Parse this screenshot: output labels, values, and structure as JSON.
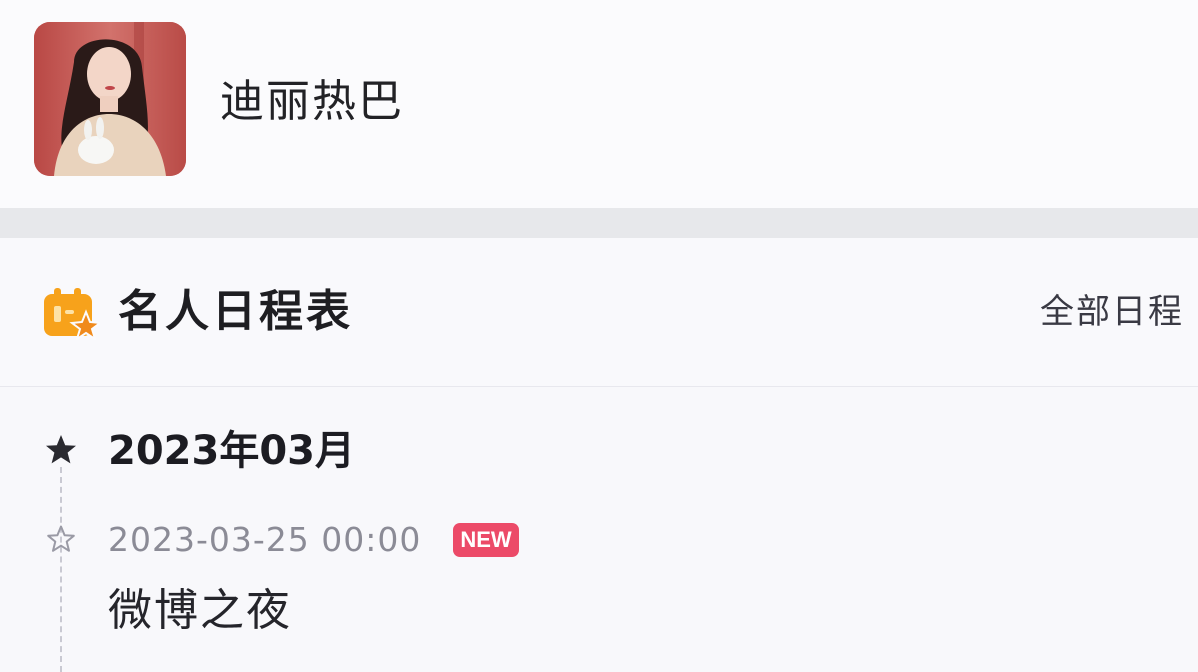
{
  "profile": {
    "name": "迪丽热巴",
    "avatar_icon": "person-avatar"
  },
  "schedule": {
    "icon": "calendar-star-icon",
    "title": "名人日程表",
    "all_link_label": "全部日程",
    "months": [
      {
        "label": "2023年03月",
        "icon": "filled-star-icon",
        "events": [
          {
            "datetime": "2023-03-25 00:00",
            "badge": "NEW",
            "title": "微博之夜",
            "icon": "outline-star-icon"
          }
        ]
      }
    ]
  },
  "colors": {
    "accent_orange": "#f7a21b",
    "badge_red": "#ec4a68",
    "muted_text": "#8b8b96"
  }
}
